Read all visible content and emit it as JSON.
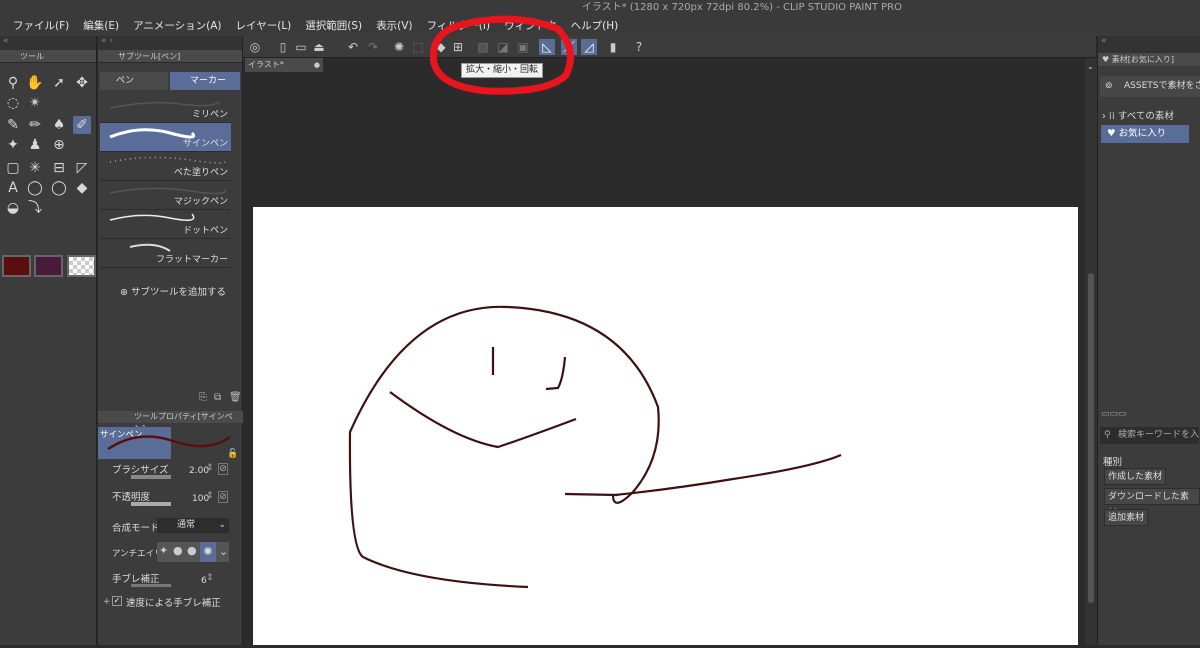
{
  "window": {
    "title": "イラスト* (1280 x 720px 72dpi 80.2%) - CLIP STUDIO PAINT PRO"
  },
  "menu": [
    "ファイル(F)",
    "編集(E)",
    "アニメーション(A)",
    "レイヤー(L)",
    "選択範囲(S)",
    "表示(V)",
    "フィルター(I)",
    "ウィンドウ",
    "ヘルプ(H)"
  ],
  "tooltip": "拡大・縮小・回転",
  "tool_panel": {
    "header": "ツール"
  },
  "subtool_panel": {
    "header": "サブツール[ペン]",
    "tabs": [
      "ペン",
      "マーカー"
    ],
    "brushes": [
      "ミリペン",
      "サインペン",
      "べた塗りペン",
      "マジックペン",
      "ドットペン",
      "フラットマーカー"
    ],
    "add_button": "サブツールを追加する"
  },
  "tool_property": {
    "header": "ツールプロパティ[サインペン]",
    "preview_label": "サインペン",
    "brush_size_label": "ブラシサイズ",
    "brush_size_value": "2.00",
    "opacity_label": "不透明度",
    "opacity_value": "100",
    "blend_label": "合成モード",
    "blend_value": "通常",
    "antialias_label": "アンチエイリアス",
    "stabilization_label": "手ブレ補正",
    "stabilization_value": "6",
    "speed_stabilization_label": "速度による手ブレ補正"
  },
  "document": {
    "tab_label": "イラスト*"
  },
  "material_panel": {
    "header": "素材[お気に入り]",
    "assets_button": "ASSETSで素材をさがす",
    "tree": [
      "すべての素材",
      "お気に入り"
    ],
    "search_placeholder": "検索キーワードを入...",
    "category_label": "種別",
    "category_buttons": [
      "作成した素材",
      "ダウンロードした素材",
      "追加素材"
    ]
  },
  "colors": {
    "main_color": "#5a0f0f",
    "sub_color": "#4a1a3c",
    "accent": "#5a6d99",
    "stroke": "#3f1010",
    "annotation": "#e8141e"
  }
}
